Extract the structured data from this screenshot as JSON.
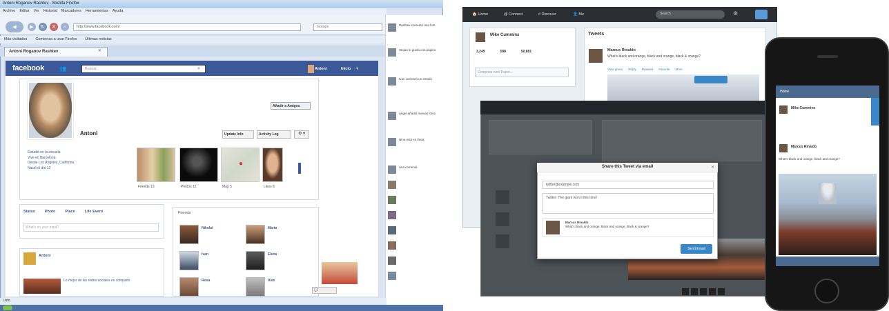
{
  "facebook_window": {
    "title": "Antoni Roganov Rashtev - Mozilla Firefox",
    "menu": [
      "Archivo",
      "Editar",
      "Ver",
      "Historial",
      "Marcadores",
      "Herramientas",
      "Ayuda"
    ],
    "url": "http://www.facebook.com/",
    "search_placeholder": "Google",
    "bookmarks": [
      "Más visitados",
      "Comienza a usar Firefox",
      "Últimas noticias"
    ],
    "tab_label": "Antoni Roganov Rashtev",
    "fb": {
      "logo": "facebook",
      "search_placeholder": "Buscar",
      "user_name": "Antoni",
      "home_label": "Inicio",
      "add_friend": "Añadir a Amigos",
      "profile_name": "Antoni",
      "update_info": "Update Info",
      "activity_log": "Activity Log",
      "gear": "⚙ ▾",
      "info_lines": [
        "Estudió en la escuela",
        "Vive en Barcelona",
        "Desde Los Ángeles, California",
        "Nació el día 12"
      ],
      "thumb_labels": [
        "Friends 13",
        "Photos 12",
        "Map 5",
        "Likes 8"
      ],
      "composer": {
        "options": [
          "Status",
          "Photo",
          "Place",
          "Life Event"
        ],
        "placeholder": "What's on your mind?"
      },
      "post_author": "Antoni",
      "post_text": "Lo mejor de las redes sociales es compartir",
      "friends_header": "Friends",
      "friends": [
        "Nikolai",
        "Marta",
        "Ivan",
        "Elena",
        "Rosa",
        "Alex"
      ],
      "status_text": "Listo"
    },
    "ticker": [
      "Rashtev comentó una foto",
      "Stojan le gusta una página",
      "Ivan comentó un estado",
      "Angel añadió nuevas fotos",
      "Nina está en línea",
      "Ana comentó"
    ]
  },
  "twitter": {
    "nav": [
      "Home",
      "Connect",
      "Discover",
      "Me"
    ],
    "search_placeholder": "Search",
    "profile_name": "Mike Cummins",
    "profile_stats": [
      "3,249",
      "588",
      "50,881"
    ],
    "compose_placeholder": "Compose new Tweet...",
    "tweets_header": "Tweets",
    "tweet_author": "Marcus Rinaldo",
    "tweet_text": "What's black and orange, black and orange, black & orange?",
    "tweet_actions": [
      "View photo",
      "Reply",
      "Retweet",
      "Favorite",
      "More"
    ],
    "dialog": {
      "title": "Share this Tweet via email",
      "to_value": "twitter@example.com",
      "message": "Twitter: The giant won it this time!",
      "tweet_author": "Marcus Rinaldo",
      "tweet_text": "What's black and orange, black and orange, black & orange?",
      "send_label": "Send Email"
    },
    "phone": {
      "top_bar": "Home",
      "profile_name": "Mike Cummins",
      "tweet_author": "Marcus Rinaldo",
      "tweet_text": "What's black and orange, black and orange?"
    }
  },
  "colors": {
    "facebook_blue": "#3b5998",
    "twitter_dark": "#2b2f33",
    "twitter_blue": "#3a87c8"
  }
}
